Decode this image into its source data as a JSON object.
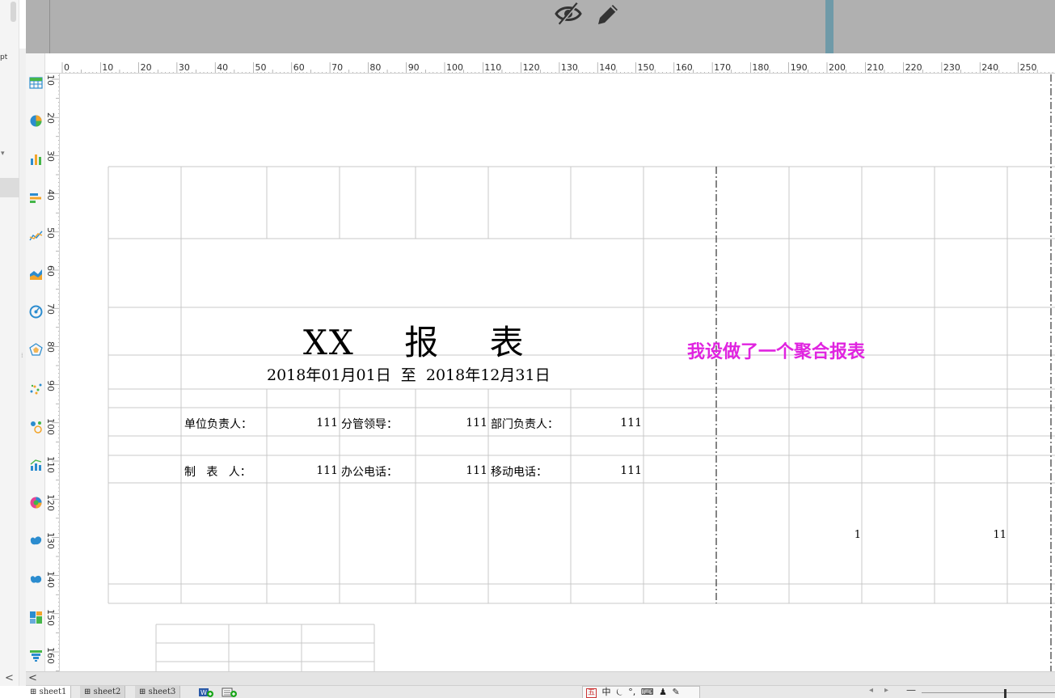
{
  "left_strip": {
    "label": "pt"
  },
  "ruler": {
    "h_labels": [
      "0",
      "10",
      "20",
      "30",
      "40",
      "50",
      "60",
      "70",
      "80",
      "90",
      "100",
      "110",
      "120",
      "130",
      "140",
      "150",
      "160",
      "170",
      "180",
      "190",
      "200",
      "210",
      "220",
      "230",
      "240",
      "250"
    ],
    "v_labels": [
      "10",
      "20",
      "30",
      "40",
      "50",
      "60",
      "70",
      "80",
      "90",
      "100",
      "110",
      "120",
      "130",
      "140",
      "150",
      "160"
    ]
  },
  "toolbar_icons": [
    "table-icon",
    "pie-chart-icon",
    "bar-chart-icon",
    "horizontal-bar-icon",
    "line-chart-icon",
    "area-chart-icon",
    "gauge-icon",
    "radar-chart-icon",
    "scatter-icon",
    "bubble-chart-icon",
    "combo-chart-icon",
    "ring-chart-icon",
    "map-icon",
    "map-alt-icon",
    "treemap-icon",
    "funnel-icon"
  ],
  "report": {
    "title": "XX    报    表",
    "date_range": "2018年01月01日  至  2018年12月31日",
    "row1": {
      "label1": "单位负责人：",
      "value1": "111",
      "label2": "分管领导：",
      "value2": "111",
      "label3": "部门负责人：",
      "value3": "111"
    },
    "row2": {
      "label1": "制   表   人：",
      "value1": "111",
      "label2": "办公电话：",
      "value2": "111",
      "label3": "移动电话：",
      "value3": "111"
    },
    "data_values": [
      "1",
      "11"
    ]
  },
  "annotation": "我设做了一个聚合报表",
  "sheets": [
    {
      "label": "sheet1",
      "active": true
    },
    {
      "label": "sheet2",
      "active": false
    },
    {
      "label": "sheet3",
      "active": false
    }
  ],
  "ime": {
    "item1": "五",
    "item2": "中",
    "item3": "⏾",
    "item4": "°,",
    "item5": "⌨",
    "item6": "♟",
    "item7": "✎"
  },
  "colors": {
    "annotation": "#e024e0",
    "top_area": "#b0b0b0",
    "teal_bar": "#6f9aa8"
  }
}
